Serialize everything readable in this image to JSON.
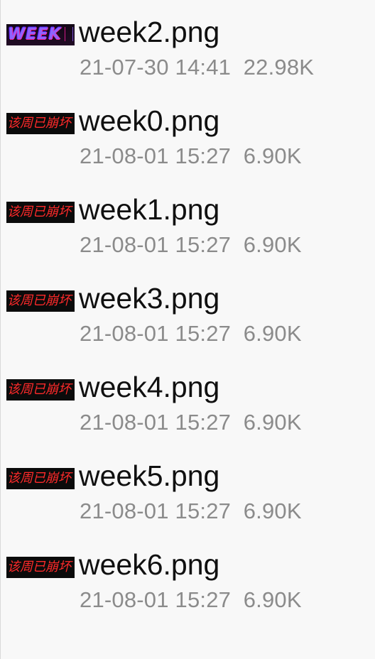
{
  "files": [
    {
      "name": "week2.png",
      "date": "21-07-30 14:41",
      "size": "22.98K",
      "thumbnail": {
        "type": "week-logo",
        "text": "WEEK",
        "accent": "#8f63ff",
        "outline": "#ff1ea2"
      }
    },
    {
      "name": "week0.png",
      "date": "21-08-01 15:27",
      "size": "6.90K",
      "thumbnail": {
        "type": "banner",
        "text": "该周已崩坏",
        "color": "#ff2a2a"
      }
    },
    {
      "name": "week1.png",
      "date": "21-08-01 15:27",
      "size": "6.90K",
      "thumbnail": {
        "type": "banner",
        "text": "该周已崩坏",
        "color": "#ff2a2a"
      }
    },
    {
      "name": "week3.png",
      "date": "21-08-01 15:27",
      "size": "6.90K",
      "thumbnail": {
        "type": "banner",
        "text": "该周已崩坏",
        "color": "#ff2a2a"
      }
    },
    {
      "name": "week4.png",
      "date": "21-08-01 15:27",
      "size": "6.90K",
      "thumbnail": {
        "type": "banner",
        "text": "该周已崩坏",
        "color": "#ff2a2a"
      }
    },
    {
      "name": "week5.png",
      "date": "21-08-01 15:27",
      "size": "6.90K",
      "thumbnail": {
        "type": "banner",
        "text": "该周已崩坏",
        "color": "#ff2a2a"
      }
    },
    {
      "name": "week6.png",
      "date": "21-08-01 15:27",
      "size": "6.90K",
      "thumbnail": {
        "type": "banner",
        "text": "该周已崩坏",
        "color": "#ff2a2a"
      }
    }
  ]
}
